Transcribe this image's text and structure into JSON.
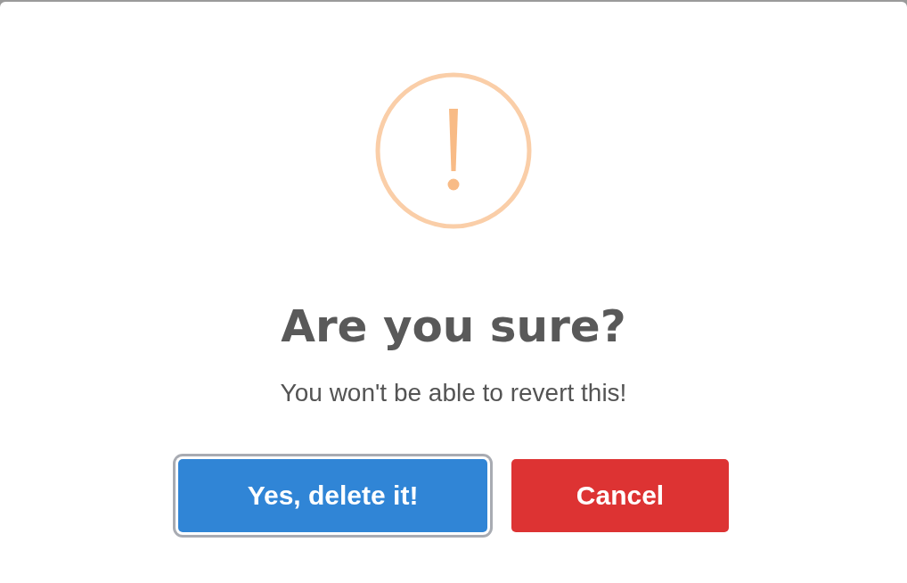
{
  "dialog": {
    "title": "Are you sure?",
    "text": "You won't be able to revert this!",
    "buttons": [
      {
        "label": "Yes, delete it!",
        "color": "#3085d6",
        "focused": true
      },
      {
        "label": "Cancel",
        "color": "#dd3333",
        "focused": false
      }
    ]
  }
}
